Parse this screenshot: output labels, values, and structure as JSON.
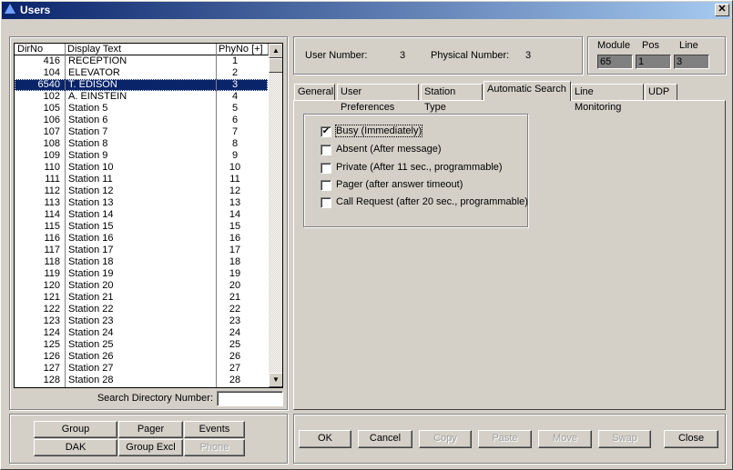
{
  "window": {
    "title": "Users",
    "close": "✕"
  },
  "list": {
    "headers": [
      "DirNo",
      "Display Text",
      "PhyNo [+]"
    ],
    "selected_index": 2,
    "rows": [
      [
        "416",
        "RECEPTION",
        "1"
      ],
      [
        "104",
        "ELEVATOR",
        "2"
      ],
      [
        "6540",
        "T. EDISON",
        "3"
      ],
      [
        "102",
        "A. EINSTEIN",
        "4"
      ],
      [
        "105",
        "Station 5",
        "5"
      ],
      [
        "106",
        "Station 6",
        "6"
      ],
      [
        "107",
        "Station 7",
        "7"
      ],
      [
        "108",
        "Station 8",
        "8"
      ],
      [
        "109",
        "Station 9",
        "9"
      ],
      [
        "110",
        "Station 10",
        "10"
      ],
      [
        "111",
        "Station 11",
        "11"
      ],
      [
        "112",
        "Station 12",
        "12"
      ],
      [
        "113",
        "Station 13",
        "13"
      ],
      [
        "114",
        "Station 14",
        "14"
      ],
      [
        "115",
        "Station 15",
        "15"
      ],
      [
        "116",
        "Station 16",
        "16"
      ],
      [
        "117",
        "Station 17",
        "17"
      ],
      [
        "118",
        "Station 18",
        "18"
      ],
      [
        "119",
        "Station 19",
        "19"
      ],
      [
        "120",
        "Station 20",
        "20"
      ],
      [
        "121",
        "Station 21",
        "21"
      ],
      [
        "122",
        "Station 22",
        "22"
      ],
      [
        "123",
        "Station 23",
        "23"
      ],
      [
        "124",
        "Station 24",
        "24"
      ],
      [
        "125",
        "Station 25",
        "25"
      ],
      [
        "126",
        "Station 26",
        "26"
      ],
      [
        "127",
        "Station 27",
        "27"
      ],
      [
        "128",
        "Station 28",
        "28"
      ]
    ]
  },
  "search": {
    "label": "Search Directory Number:",
    "value": ""
  },
  "left_buttons": {
    "group": "Group",
    "pager": "Pager",
    "events": "Events",
    "dak": "DAK",
    "group_excl": "Group Excl",
    "phone": "Phone"
  },
  "info": {
    "user_number_label": "User Number:",
    "user_number": "3",
    "physical_number_label": "Physical Number:",
    "physical_number": "3",
    "module_label": "Module",
    "pos_label": "Pos",
    "line_label": "Line",
    "module": "65",
    "pos": "1",
    "line": "3"
  },
  "tabs": [
    "General",
    "User Preferences",
    "Station Type",
    "Automatic Search",
    "Line Monitoring",
    "UDP"
  ],
  "active_tab": "Automatic Search",
  "options": [
    {
      "label": "Busy (Immediately)",
      "checked": true
    },
    {
      "label": "Absent (After message)",
      "checked": false
    },
    {
      "label": "Private (After 11 sec., programmable)",
      "checked": false
    },
    {
      "label": "Pager (after answer timeout)",
      "checked": false
    },
    {
      "label": "Call Request (after 20 sec., programmable)",
      "checked": false
    }
  ],
  "actions": {
    "ok": "OK",
    "cancel": "Cancel",
    "copy": "Copy",
    "paste": "Paste",
    "move": "Move",
    "swap": "Swap",
    "close": "Close"
  }
}
